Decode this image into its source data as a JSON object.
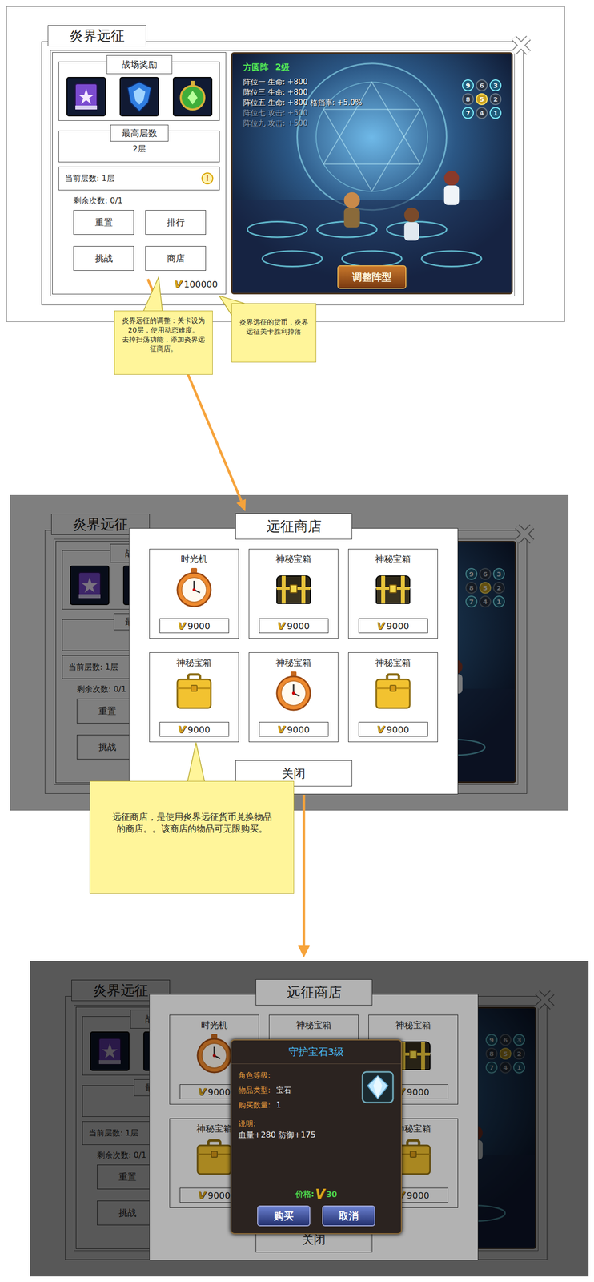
{
  "scenes": [
    {
      "kind": "main"
    },
    {
      "kind": "shop"
    },
    {
      "kind": "purchase"
    }
  ],
  "expedition_window": {
    "title": "炎界远征",
    "rewards": {
      "title": "战场奖励",
      "items": [
        {
          "kind": "book",
          "color": "#7b4bd0"
        },
        {
          "kind": "crest",
          "color": "#2f7de0"
        },
        {
          "kind": "amulet",
          "color": "#3fae3a"
        }
      ]
    },
    "best_floor": {
      "title": "最高层数",
      "value": "2层"
    },
    "current_floor": {
      "text": "当前层数: 1层",
      "info_icon": "!"
    },
    "remaining": "剩余次数: 0/1",
    "buttons": [
      {
        "label": "重置"
      },
      {
        "label": "排行"
      },
      {
        "label": "挑战"
      },
      {
        "label": "商店"
      }
    ],
    "currency": {
      "icon": "V",
      "amount": "100000"
    },
    "formation": {
      "name": "方圆阵",
      "level": "2级",
      "lines": [
        {
          "text": "阵位一 生命: +800",
          "dimmed": false
        },
        {
          "text": "阵位三 生命: +800",
          "dimmed": false
        },
        {
          "text": "阵位五 生命: +800 格挡率: +5.0%",
          "dimmed": false
        },
        {
          "text": "阵位七 攻击: +500",
          "dimmed": true
        },
        {
          "text": "阵位九 攻击: +500",
          "dimmed": true
        }
      ],
      "grid": [
        {
          "label": "9",
          "active": true,
          "selected": false
        },
        {
          "label": "6",
          "active": false,
          "selected": false
        },
        {
          "label": "3",
          "active": true,
          "selected": false
        },
        {
          "label": "8",
          "active": false,
          "selected": false
        },
        {
          "label": "5",
          "active": true,
          "selected": true
        },
        {
          "label": "2",
          "active": false,
          "selected": false
        },
        {
          "label": "7",
          "active": true,
          "selected": false
        },
        {
          "label": "4",
          "active": false,
          "selected": false
        },
        {
          "label": "1",
          "active": true,
          "selected": false
        }
      ],
      "button": "调整阵型"
    }
  },
  "shop": {
    "title": "远征商店",
    "currency_icon": "V",
    "items": [
      {
        "name": "时光机",
        "kind": "clock",
        "price": "9000"
      },
      {
        "name": "神秘宝箱",
        "kind": "chest",
        "price": "9000"
      },
      {
        "name": "神秘宝箱",
        "kind": "chest",
        "price": "9000"
      },
      {
        "name": "神秘宝箱",
        "kind": "case",
        "price": "9000"
      },
      {
        "name": "神秘宝箱",
        "kind": "clock",
        "price": "9000"
      },
      {
        "name": "神秘宝箱",
        "kind": "case",
        "price": "9000"
      }
    ],
    "close": "关闭"
  },
  "purchase_popup": {
    "title": "守护宝石3级",
    "fields": [
      {
        "label": "角色等级:"
      },
      {
        "label": "物品类型:",
        "value": "宝石"
      },
      {
        "label": "购买数量:",
        "value": "1"
      }
    ],
    "desc_label": "说明:",
    "desc": "血量+280 防御+175",
    "price_label": "价格:",
    "currency_icon": "V",
    "price": "30",
    "buttons": [
      "购买",
      "取消"
    ]
  },
  "notes": [
    {
      "lines": [
        "炎界远征的调整：关卡设为20层，使用动态难度。",
        "去掉扫荡功能，添加炎界远征商店。"
      ]
    },
    {
      "lines": [
        "炎界远征的货币，炎界远征关卡胜利掉落"
      ]
    },
    {
      "lines": [
        "远征商店，是使用炎界远征货币兑换物品的商店。。该商店的物品可无限购买。"
      ]
    }
  ]
}
